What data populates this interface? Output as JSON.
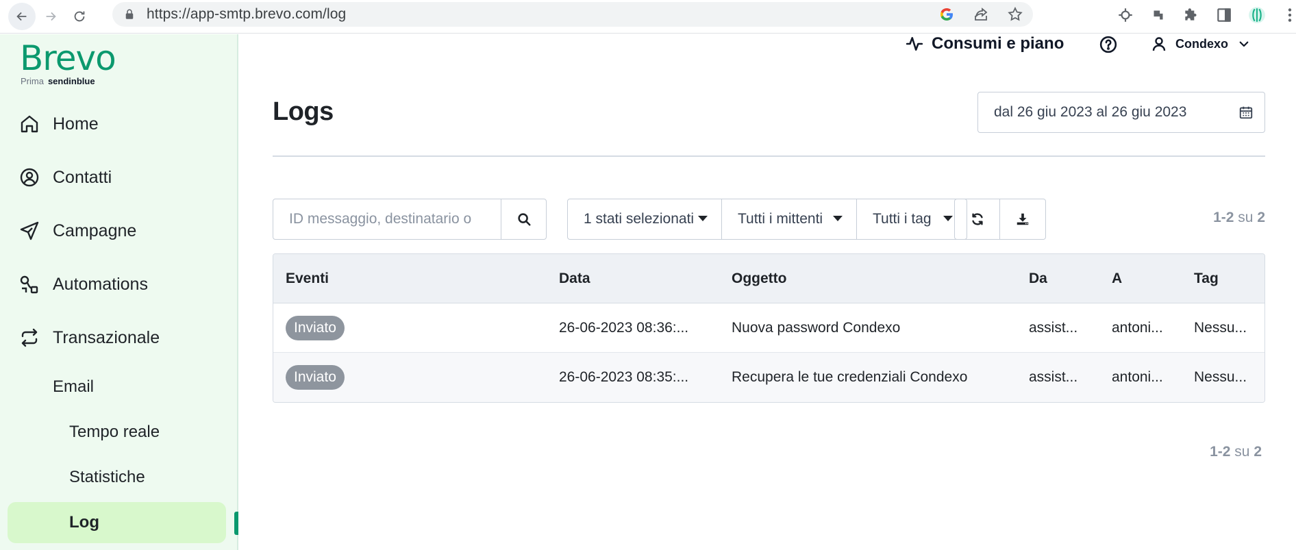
{
  "browser": {
    "url": "https://app-smtp.brevo.com/log"
  },
  "sidebar": {
    "logo": {
      "word": "Brevo",
      "prima": "Prima",
      "sendinblue": "sendinblue"
    },
    "items": [
      {
        "label": "Home",
        "icon": "home-icon"
      },
      {
        "label": "Contatti",
        "icon": "contacts-icon"
      },
      {
        "label": "Campagne",
        "icon": "send-icon"
      },
      {
        "label": "Automations",
        "icon": "automation-icon"
      },
      {
        "label": "Transazionale",
        "icon": "transactional-icon"
      }
    ],
    "sub_items": [
      {
        "label": "Email"
      },
      {
        "label": "Tempo reale"
      },
      {
        "label": "Statistiche"
      },
      {
        "label": "Log",
        "active": true
      }
    ]
  },
  "topbar": {
    "usage": "Consumi e piano",
    "account": "Condexo"
  },
  "page": {
    "title": "Logs",
    "date_range": "dal 26 giu 2023 al 26 giu 2023"
  },
  "filters": {
    "search_placeholder": "ID messaggio, destinatario o",
    "status": "1 stati selezionati",
    "senders": "Tutti i mittenti",
    "tags": "Tutti i tag"
  },
  "pagination": {
    "range": "1-2",
    "of": "su",
    "total": "2"
  },
  "table": {
    "columns": [
      "Eventi",
      "Data",
      "Oggetto",
      "Da",
      "A",
      "Tag"
    ],
    "rows": [
      {
        "event": "Inviato",
        "date": "26-06-2023 08:36:...",
        "subject": "Nuova password Condexo",
        "from": "assist...",
        "to": "antoni...",
        "tag": "Nessu..."
      },
      {
        "event": "Inviato",
        "date": "26-06-2023 08:35:...",
        "subject": "Recupera le tue credenziali Condexo",
        "from": "assist...",
        "to": "antoni...",
        "tag": "Nessu..."
      }
    ]
  },
  "colors": {
    "brand": "#0b996e",
    "sidebar_bg": "#eefaf0",
    "active_bg": "#d8f8cc",
    "badge_bg": "#8e959e"
  }
}
